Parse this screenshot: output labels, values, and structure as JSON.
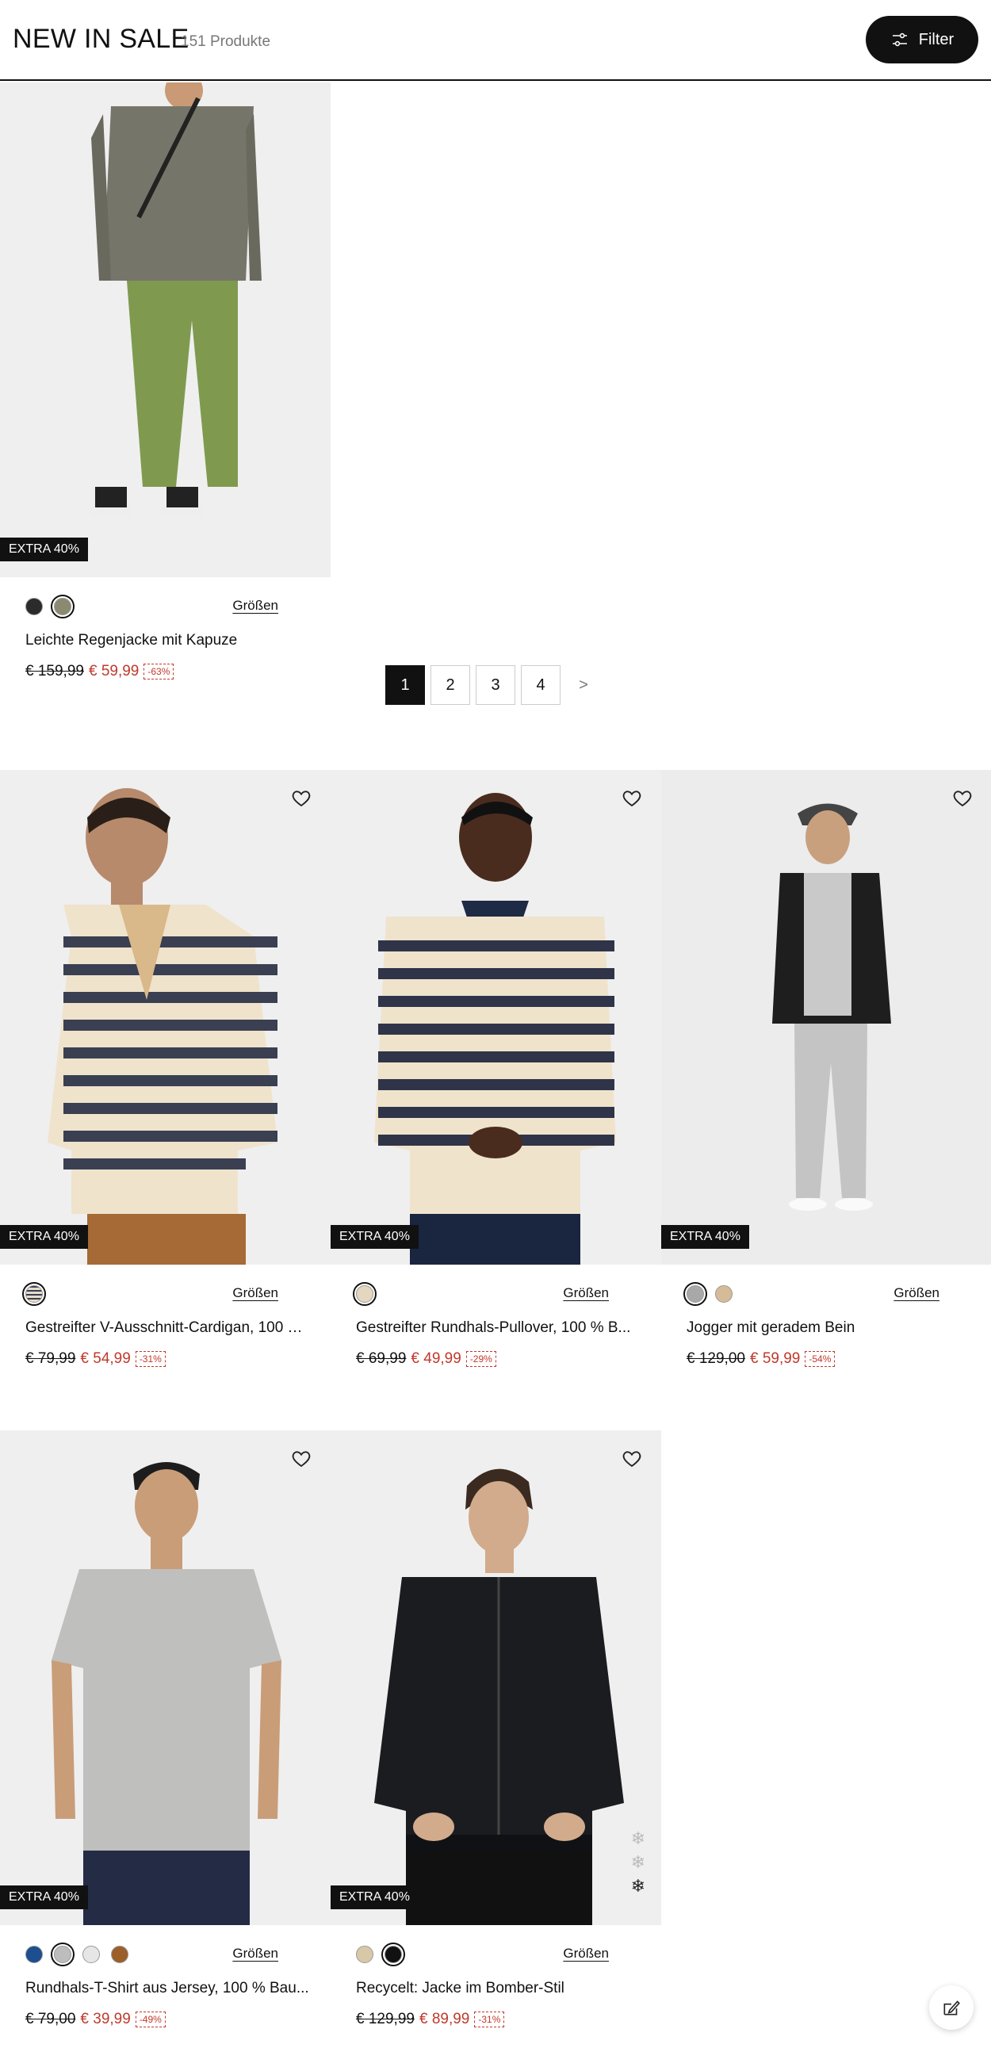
{
  "header": {
    "title": "NEW IN SALE",
    "count": "151 Produkte",
    "filter_label": "Filter"
  },
  "pagination": {
    "pages": [
      "1",
      "2",
      "3",
      "4"
    ],
    "current": "1",
    "next": ">"
  },
  "products": [
    {
      "name": "Leichte Regenjacke mit Kapuze",
      "old_price": "€ 159,99",
      "new_price": "€ 59,99",
      "discount": "-63%",
      "badge": "EXTRA 40%",
      "sizes_label": "Größen",
      "swatches": [
        "#2b2b2b",
        "#8a8a70"
      ],
      "selected_swatch": 1
    },
    {
      "name": "Gestreifter V-Ausschnitt-Cardigan, 100 …",
      "old_price": "€ 79,99",
      "new_price": "€ 54,99",
      "discount": "-31%",
      "badge": "EXTRA 40%",
      "sizes_label": "Größen",
      "swatches": [
        "#e6dccb"
      ],
      "selected_swatch": 0
    },
    {
      "name": "Gestreifter Rundhals-Pullover, 100 % B...",
      "old_price": "€ 69,99",
      "new_price": "€ 49,99",
      "discount": "-29%",
      "badge": "EXTRA 40%",
      "sizes_label": "Größen",
      "swatches": [
        "#e3d7bf"
      ],
      "selected_swatch": 0
    },
    {
      "name": "Jogger mit geradem Bein",
      "old_price": "€ 129,00",
      "new_price": "€ 59,99",
      "discount": "-54%",
      "badge": "EXTRA 40%",
      "sizes_label": "Größen",
      "swatches": [
        "#a8a8a8",
        "#d6bc96"
      ],
      "selected_swatch": 0
    },
    {
      "name": "Rundhals-T-Shirt aus Jersey, 100 % Bau...",
      "old_price": "€ 79,00",
      "new_price": "€ 39,99",
      "discount": "-49%",
      "badge": "EXTRA 40%",
      "sizes_label": "Größen",
      "swatches": [
        "#1d4e8f",
        "#bdbdbd",
        "#e6e6e6",
        "#9c5f2a"
      ],
      "selected_swatch": 1
    },
    {
      "name": "Recycelt: Jacke im Bomber-Stil",
      "old_price": "€ 129,99",
      "new_price": "€ 89,99",
      "discount": "-31%",
      "badge": "EXTRA 40%",
      "sizes_label": "Größen",
      "swatches": [
        "#d9c8a8",
        "#111111"
      ],
      "selected_swatch": 1
    }
  ],
  "colors": {
    "accent_sale": "#c0392b",
    "badge_bg": "#111111",
    "image_bg": "#efefef"
  }
}
